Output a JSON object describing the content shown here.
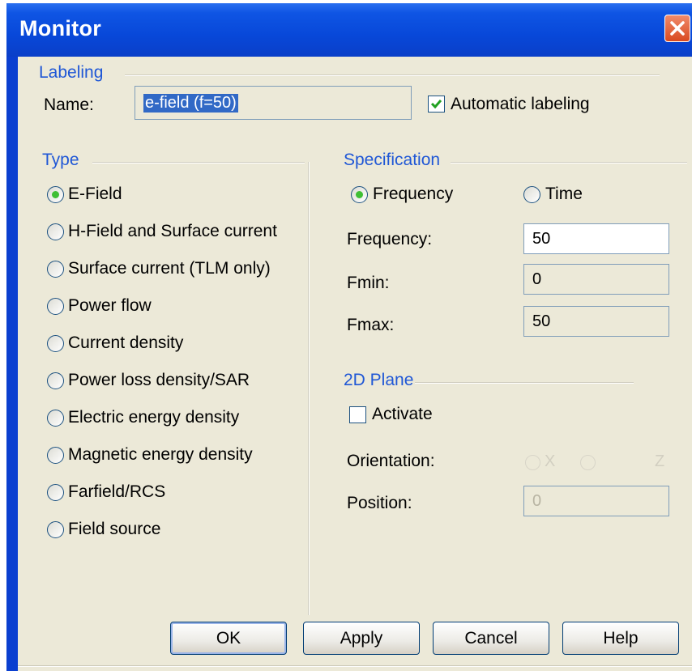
{
  "window": {
    "title": "Monitor",
    "close_icon": "close-icon"
  },
  "labeling": {
    "group_label": "Labeling",
    "name_label": "Name:",
    "name_value": "e-field (f=50)",
    "auto_label": "Automatic labeling",
    "auto_checked": true
  },
  "type": {
    "group_label": "Type",
    "options": [
      {
        "label": "E-Field",
        "selected": true
      },
      {
        "label": "H-Field and Surface current",
        "selected": false
      },
      {
        "label": "Surface current (TLM only)",
        "selected": false
      },
      {
        "label": "Power flow",
        "selected": false
      },
      {
        "label": "Current density",
        "selected": false
      },
      {
        "label": "Power loss density/SAR",
        "selected": false
      },
      {
        "label": "Electric energy density",
        "selected": false
      },
      {
        "label": "Magnetic energy density",
        "selected": false
      },
      {
        "label": "Farfield/RCS",
        "selected": false
      },
      {
        "label": "Field source",
        "selected": false
      }
    ]
  },
  "specification": {
    "group_label": "Specification",
    "frequency_radio": "Frequency",
    "time_radio": "Time",
    "frequency_label": "Frequency:",
    "frequency_value": "50",
    "fmin_label": "Fmin:",
    "fmin_value": "0",
    "fmax_label": "Fmax:",
    "fmax_value": "50"
  },
  "plane": {
    "group_label": "2D Plane",
    "activate_label": "Activate",
    "activate_checked": false,
    "orientation_label": "Orientation:",
    "orientation_x": "X",
    "orientation_z": "Z",
    "position_label": "Position:",
    "position_value": "0"
  },
  "buttons": {
    "ok": "OK",
    "apply": "Apply",
    "cancel": "Cancel",
    "help": "Help"
  },
  "colors": {
    "title_bar": "#0a3fd0",
    "dialog_bg": "#ece9d8",
    "group_label": "#1f57d6",
    "radio_selected": "#3fbf34"
  }
}
